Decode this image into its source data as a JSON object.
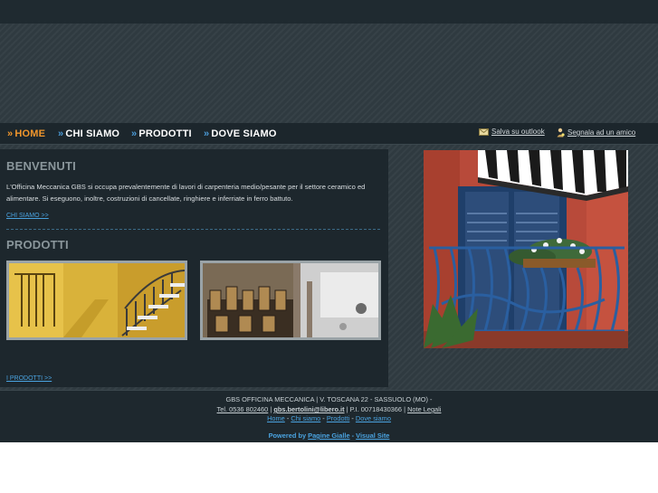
{
  "nav": {
    "items": [
      {
        "label": "HOME",
        "active": true
      },
      {
        "label": "CHI SIAMO",
        "active": false
      },
      {
        "label": "PRODOTTI",
        "active": false
      },
      {
        "label": "DOVE SIAMO",
        "active": false
      }
    ],
    "chevron": "»",
    "utility": {
      "outlook": "Salva su outlook",
      "friend": "Segnala ad un amico"
    }
  },
  "welcome": {
    "title": "BENVENUTI",
    "text": "L'Officina Meccanica GBS si occupa prevalentemente di lavori di carpenteria medio/pesante per il settore ceramico ed alimentare. Si eseguono, inoltre, costruzioni di cancellate, ringhiere e inferriate in ferro battuto.",
    "link": "CHI SIAMO >>"
  },
  "products": {
    "title": "PRODOTTI",
    "link": "I PRODOTTI >>"
  },
  "footer": {
    "line1": "GBS OFFICINA MECCANICA | V. TOSCANA 22 - SASSUOLO (MO) -",
    "tel": "Tel. 0536 802460",
    "email": "gbs.bertolini@libero.it",
    "piva": "P.I. 00718430366",
    "legal": "Note Legali",
    "links": [
      "Home",
      "Chi siamo",
      "Prodotti",
      "Dove siamo"
    ],
    "link_sep": "-",
    "pipe": "|",
    "powered_label": "Powered by",
    "powered_pg": "Pagine Gialle",
    "powered_vs": "Visual Site"
  },
  "colors": {
    "accent_active": "#f0962c",
    "link_blue": "#4aa3e0",
    "background_dark": "#1d272d"
  },
  "icons": [
    "outlook-icon",
    "friend-icon",
    "chevron-icon"
  ]
}
